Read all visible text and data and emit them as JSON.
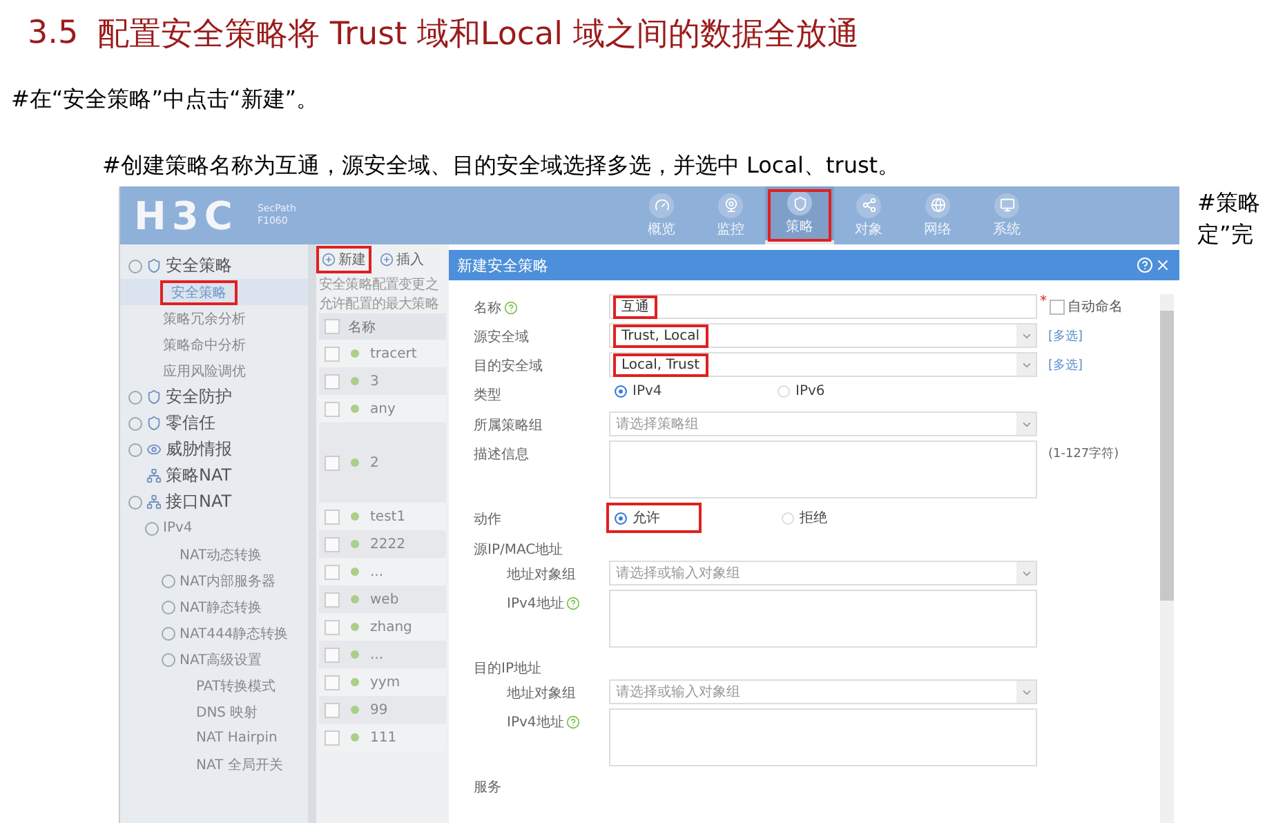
{
  "heading": {
    "number": "3.5",
    "title": "配置安全策略将 Trust 域和Local 域之间的数据全放通"
  },
  "steps": [
    "#在“安全策略”中点击“新建”。",
    "#创建策略名称为互通，源安全域、目的安全域选择多选，并选中  Local、trust。"
  ],
  "side_note": [
    "#策略",
    "定”完"
  ],
  "app": {
    "logo": "H3C",
    "product": [
      "SecPath",
      "F1060"
    ],
    "nav": [
      {
        "label": "概览",
        "selected": false,
        "highlighted": false
      },
      {
        "label": "监控",
        "selected": false,
        "highlighted": false
      },
      {
        "label": "策略",
        "selected": true,
        "highlighted": true
      },
      {
        "label": "对象",
        "selected": false,
        "highlighted": false
      },
      {
        "label": "网络",
        "selected": false,
        "highlighted": false
      },
      {
        "label": "系统",
        "selected": false,
        "highlighted": false
      }
    ],
    "sidebar": [
      {
        "label": "安全策略",
        "expander": true,
        "selected": false,
        "highlighted": false,
        "children": [
          {
            "label": "安全策略",
            "expander": false,
            "selected": true,
            "highlighted": true
          },
          {
            "label": "策略冗余分析",
            "expander": false,
            "selected": false,
            "highlighted": false
          },
          {
            "label": "策略命中分析",
            "expander": false,
            "selected": false,
            "highlighted": false
          },
          {
            "label": "应用风险调优",
            "expander": false,
            "selected": false,
            "highlighted": false
          }
        ]
      },
      {
        "label": "安全防护",
        "expander": true,
        "selected": false,
        "highlighted": false
      },
      {
        "label": "零信任",
        "expander": true,
        "selected": false,
        "highlighted": false
      },
      {
        "label": "威胁情报",
        "expander": true,
        "selected": false,
        "highlighted": false
      },
      {
        "label": "策略NAT",
        "expander": false,
        "selected": false,
        "highlighted": false
      },
      {
        "label": "接口NAT",
        "expander": true,
        "selected": false,
        "highlighted": false,
        "children": [
          {
            "label": "IPv4",
            "expander": true,
            "selected": false,
            "highlighted": false,
            "children": [
              {
                "label": "NAT动态转换",
                "expander": false,
                "selected": false,
                "highlighted": false
              },
              {
                "label": "NAT内部服务器",
                "expander": true,
                "selected": false,
                "highlighted": false
              },
              {
                "label": "NAT静态转换",
                "expander": true,
                "selected": false,
                "highlighted": false
              },
              {
                "label": "NAT444静态转换",
                "expander": true,
                "selected": false,
                "highlighted": false
              },
              {
                "label": "NAT高级设置",
                "expander": true,
                "selected": false,
                "highlighted": false,
                "children": [
                  {
                    "label": "PAT转换模式",
                    "expander": false,
                    "selected": false,
                    "highlighted": false
                  },
                  {
                    "label": "DNS 映射",
                    "expander": false,
                    "selected": false,
                    "highlighted": false
                  },
                  {
                    "label": "NAT Hairpin",
                    "expander": false,
                    "selected": false,
                    "highlighted": false
                  },
                  {
                    "label": "NAT 全局开关",
                    "expander": false,
                    "selected": false,
                    "highlighted": false
                  }
                ]
              }
            ]
          }
        ]
      }
    ],
    "policy_list": {
      "toolbar": [
        {
          "label": "新建",
          "highlighted": true
        },
        {
          "label": "插入",
          "highlighted": false
        }
      ],
      "notes": [
        "安全策略配置变更之",
        "允许配置的最大策略"
      ],
      "column": "名称",
      "rows": [
        {
          "name": "tracert",
          "checked": false,
          "tall": false
        },
        {
          "name": "3",
          "checked": false,
          "tall": false
        },
        {
          "name": "any",
          "checked": false,
          "tall": false
        },
        {
          "name": "2",
          "checked": false,
          "tall": true
        },
        {
          "name": "test1",
          "checked": false,
          "tall": false
        },
        {
          "name": "2222",
          "checked": false,
          "tall": false
        },
        {
          "name": "...",
          "checked": false,
          "tall": false
        },
        {
          "name": "web",
          "checked": false,
          "tall": false
        },
        {
          "name": "zhang",
          "checked": false,
          "tall": false
        },
        {
          "name": "...",
          "checked": false,
          "tall": false
        },
        {
          "name": "yym",
          "checked": false,
          "tall": false
        },
        {
          "name": "99",
          "checked": false,
          "tall": false
        },
        {
          "name": "111",
          "checked": false,
          "tall": false
        }
      ]
    },
    "dialog": {
      "title": "新建安全策略",
      "fields": [
        {
          "kind": "text",
          "label": "名称",
          "help": true,
          "value": "互通",
          "highlighted": true,
          "required_mark": "*",
          "option": {
            "label": "自动命名",
            "checked": false
          }
        },
        {
          "kind": "select",
          "label": "源安全域",
          "value": "Trust, Local",
          "highlighted": true,
          "link": "[多选]"
        },
        {
          "kind": "select",
          "label": "目的安全域",
          "value": "Local, Trust",
          "highlighted": true,
          "link": "[多选]"
        },
        {
          "kind": "radio",
          "label": "类型",
          "options": [
            {
              "label": "IPv4",
              "selected": true,
              "highlighted": false
            },
            {
              "label": "IPv6",
              "selected": false,
              "highlighted": false
            }
          ]
        },
        {
          "kind": "select",
          "label": "所属策略组",
          "placeholder": "请选择策略组"
        },
        {
          "kind": "textarea",
          "label": "描述信息",
          "hint": "(1-127字符)"
        },
        {
          "kind": "radio",
          "label": "动作",
          "options": [
            {
              "label": "允许",
              "selected": true,
              "highlighted": true
            },
            {
              "label": "拒绝",
              "selected": false,
              "highlighted": false
            }
          ]
        },
        {
          "kind": "section",
          "label": "源IP/MAC地址",
          "children": [
            {
              "kind": "select",
              "label": "地址对象组",
              "placeholder": "请选择或输入对象组"
            },
            {
              "kind": "textarea",
              "label": "IPv4地址",
              "help": true
            }
          ]
        },
        {
          "kind": "section",
          "label": "目的IP地址",
          "children": [
            {
              "kind": "select",
              "label": "地址对象组",
              "placeholder": "请选择或输入对象组"
            },
            {
              "kind": "textarea",
              "label": "IPv4地址",
              "help": true
            }
          ]
        },
        {
          "kind": "section",
          "label": "服务"
        }
      ]
    }
  }
}
